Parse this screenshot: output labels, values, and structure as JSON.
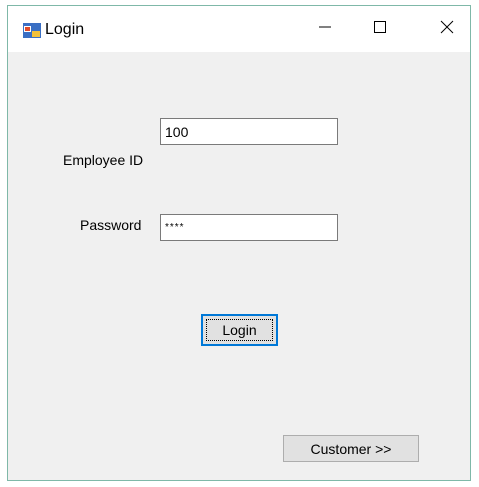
{
  "window": {
    "title": "Login",
    "icon": "winforms-app-icon"
  },
  "caption_buttons": {
    "minimize": "minimize-icon",
    "maximize": "maximize-icon",
    "close": "close-icon"
  },
  "form": {
    "employee_id_label": "Employee ID",
    "employee_id_value": "100",
    "password_label": "Password",
    "password_value": "****",
    "login_button": "Login",
    "customer_button": "Customer >>"
  },
  "colors": {
    "accent": "#0078d7",
    "form_background": "#f0f0f0",
    "window_border": "#7fb8a8"
  }
}
